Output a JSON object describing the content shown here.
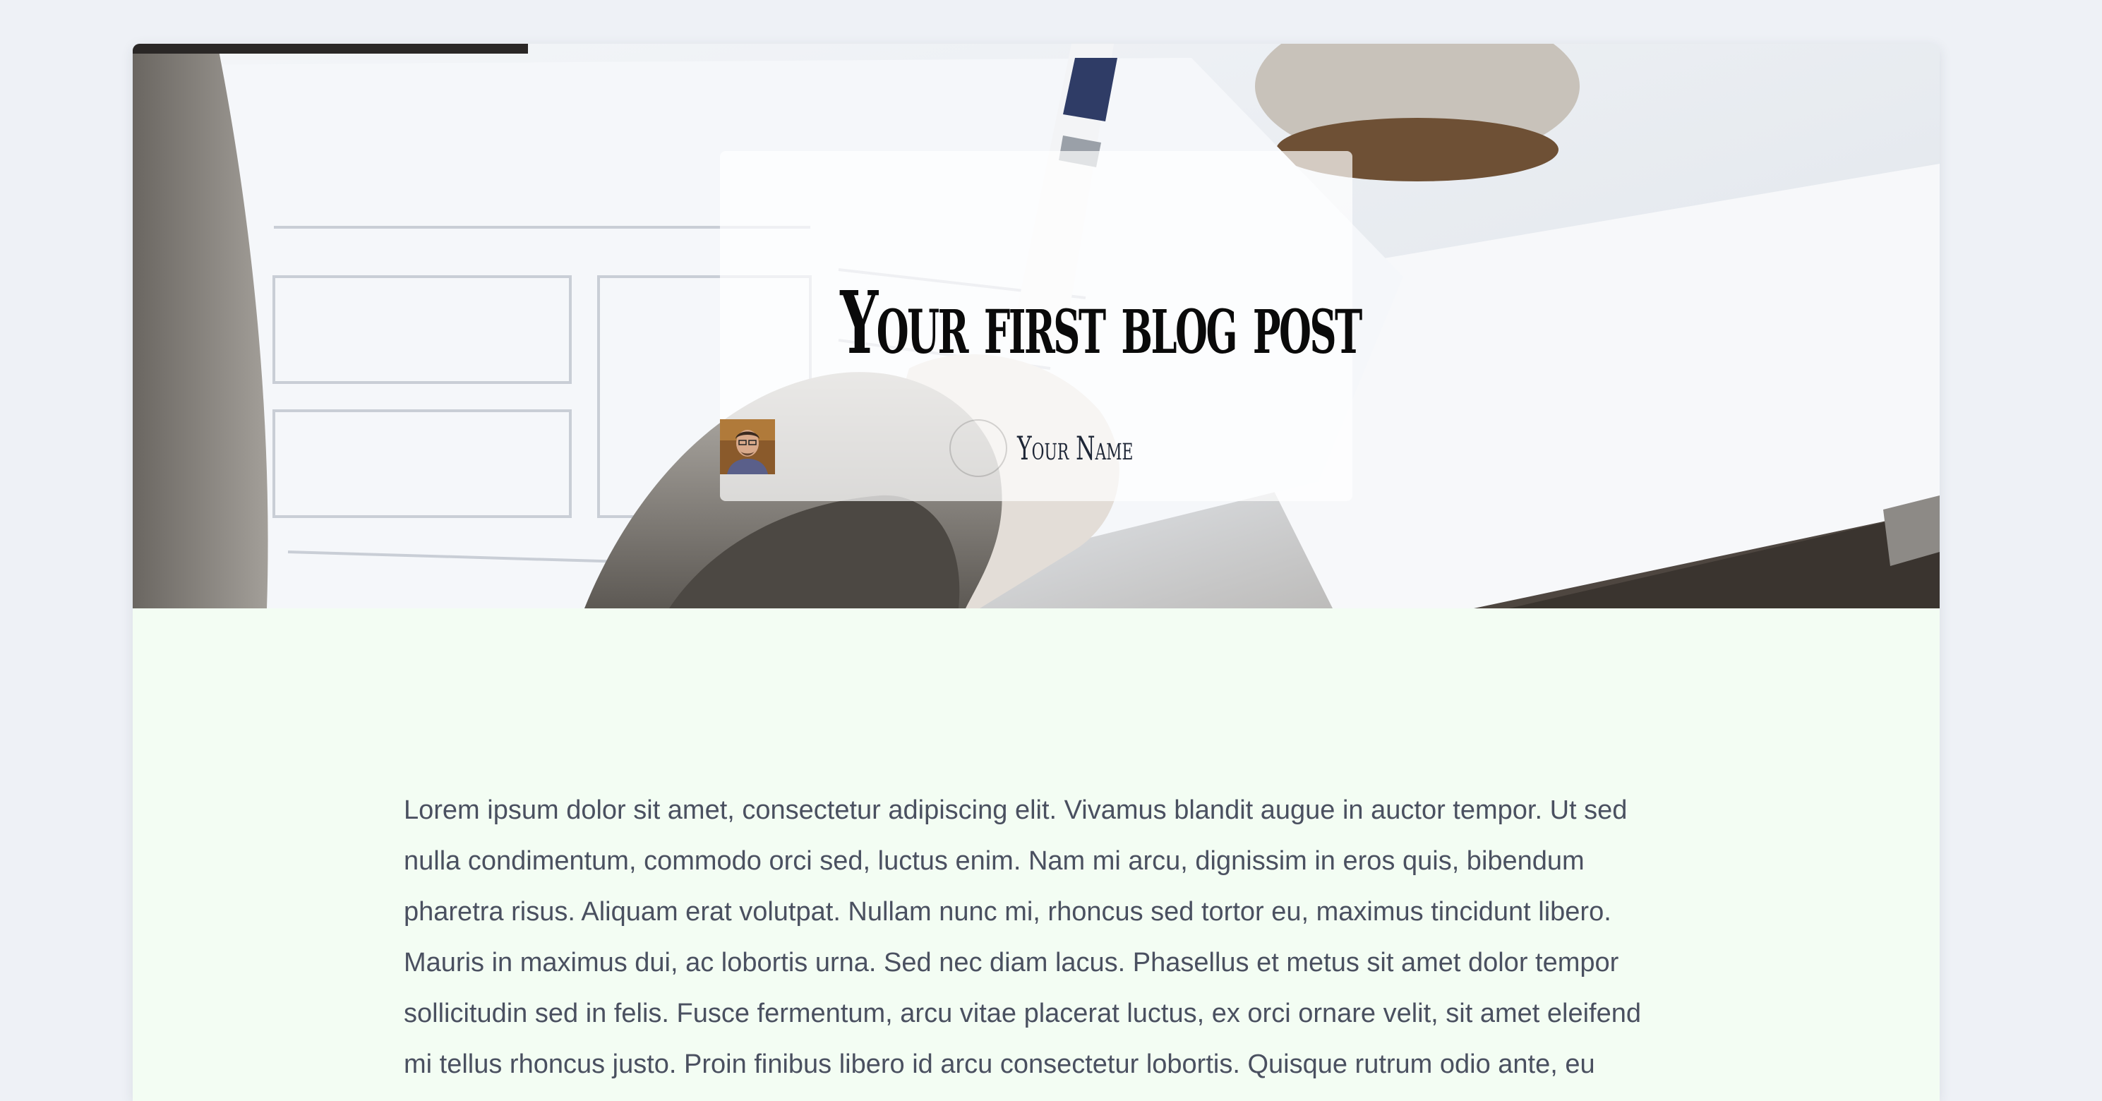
{
  "post": {
    "title": "Your first blog post",
    "author_name": "Your Name",
    "body": "Lorem ipsum dolor sit amet, consectetur adipiscing elit. Vivamus blandit augue in auctor tempor. Ut sed nulla condimentum, commodo orci sed, luctus enim. Nam mi arcu, dignissim in eros quis, bibendum pharetra risus. Aliquam erat volutpat. Nullam nunc mi, rhoncus sed tortor eu, maximus tincidunt libero. Mauris in maximus dui, ac lobortis urna. Sed nec diam lacus. Phasellus et metus sit amet dolor tempor sollicitudin sed in felis. Fusce fermentum, arcu vitae placerat luctus, ex orci ornare velit, sit amet eleifend mi tellus rhoncus justo. Proin finibus libero id arcu consectetur lobortis. Quisque rutrum odio ante, eu sollicitudin ante consectetur sit amet. Duis ut lectus dapibus, semper lacus a, hendrerit justo. Maecenas"
  },
  "colors": {
    "page_background": "#eef1f6",
    "content_background": "#f3fdf3",
    "body_text": "#4a5060",
    "title_text": "#0a0a0a"
  }
}
